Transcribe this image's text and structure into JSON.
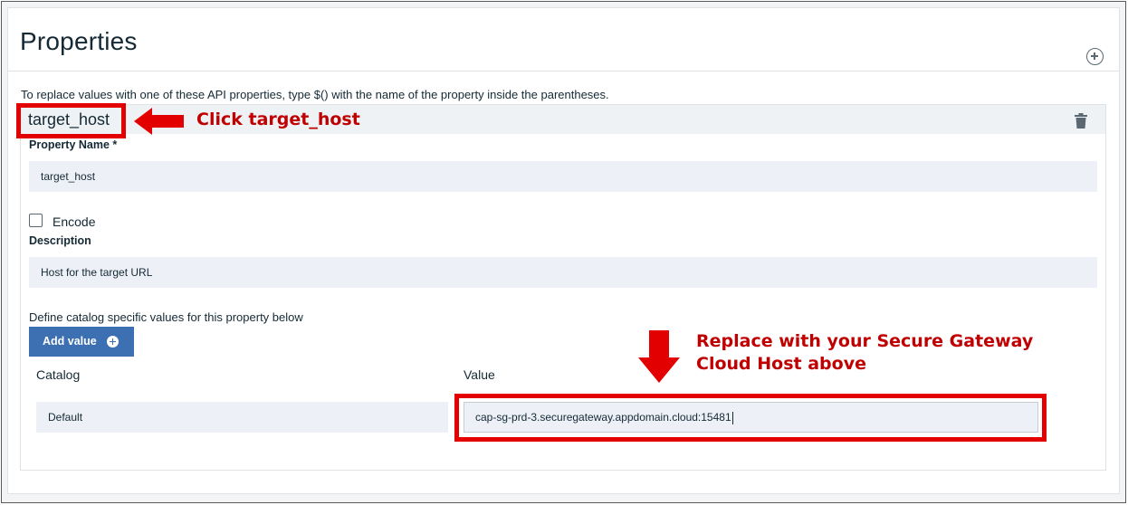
{
  "page": {
    "title": "Properties",
    "intro": "To replace values with one of these API properties, type $() with the name of the property inside the parentheses."
  },
  "property": {
    "header_name": "target_host",
    "name_label": "Property Name *",
    "name_value": "target_host",
    "encode_label": "Encode",
    "encode_checked": false,
    "description_label": "Description",
    "description_value": "Host for the target URL",
    "define_text": "Define catalog specific values for this property below",
    "add_value_label": "Add value",
    "catalog_header": "Catalog",
    "value_header": "Value",
    "rows": [
      {
        "catalog": "Default",
        "value": "cap-sg-prd-3.securegateway.appdomain.cloud:15481"
      }
    ]
  },
  "annotations": {
    "click_hint": "Click target_host",
    "replace_hint_line1": "Replace with your Secure Gateway",
    "replace_hint_line2": "Cloud Host above",
    "color": "#e30000"
  },
  "icons": {
    "add_property": "plus-circle-icon",
    "delete": "trash-icon",
    "add_value": "plus-circle-filled-icon"
  },
  "colors": {
    "primary_button": "#3d70b2",
    "field_background": "#edf1f7",
    "header_background": "#eef2f5"
  }
}
